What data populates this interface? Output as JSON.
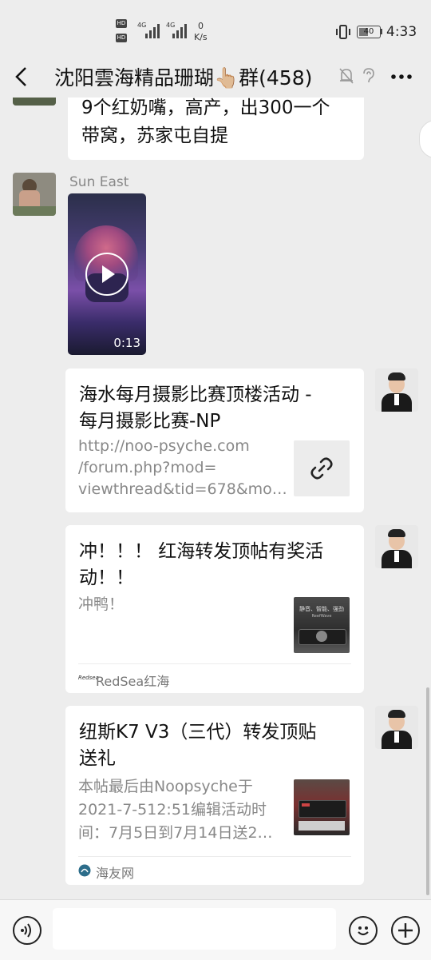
{
  "status_bar": {
    "hd1": "HD",
    "hd2": "HD",
    "net1": "4G",
    "net2": "4G",
    "speed_value": "0",
    "speed_unit": "K/s",
    "battery": "40",
    "time": "4:33"
  },
  "header": {
    "title": "沈阳雲海精品珊瑚👆🏼群(458)"
  },
  "messages": [
    {
      "type": "text",
      "side": "left",
      "lines": [
        "9个红奶嘴，高产，出300一个",
        "带窝，苏家屯自提"
      ]
    },
    {
      "type": "video",
      "side": "left",
      "sender": "Sun East",
      "duration": "0:13"
    },
    {
      "type": "link",
      "side": "right",
      "title": "海水每月摄影比赛顶楼活动 - 每月摄影比赛-NP",
      "title_lines": [
        "海水每月摄影比赛顶楼活动 -",
        "每月摄影比赛-NP"
      ],
      "desc_lines": [
        "http://noo-psyche.com",
        "/forum.php?mod=",
        "viewthread&tid=678&mo…"
      ],
      "thumb_icon": "link-icon"
    },
    {
      "type": "link",
      "side": "right",
      "title_lines": [
        "冲！！！ 红海转发顶帖有奖活",
        "动！！"
      ],
      "desc_lines": [
        "冲鸭！"
      ],
      "thumb_text": [
        "静音、智能、强劲",
        "ReefWave"
      ],
      "source_logo": "Redsea",
      "source": "RedSea红海"
    },
    {
      "type": "link",
      "side": "right",
      "title_lines": [
        "纽斯K7 V3（三代）转发顶贴",
        "送礼"
      ],
      "desc_lines": [
        "本帖最后由Noopsyche于",
        "2021-7-512:51编辑活动时",
        "间：7月5日到7月14日送2…"
      ],
      "source": "海友网"
    }
  ],
  "colors": {
    "background": "#ededed",
    "bubble": "#ffffff",
    "title": "#111111",
    "muted": "#888888"
  }
}
